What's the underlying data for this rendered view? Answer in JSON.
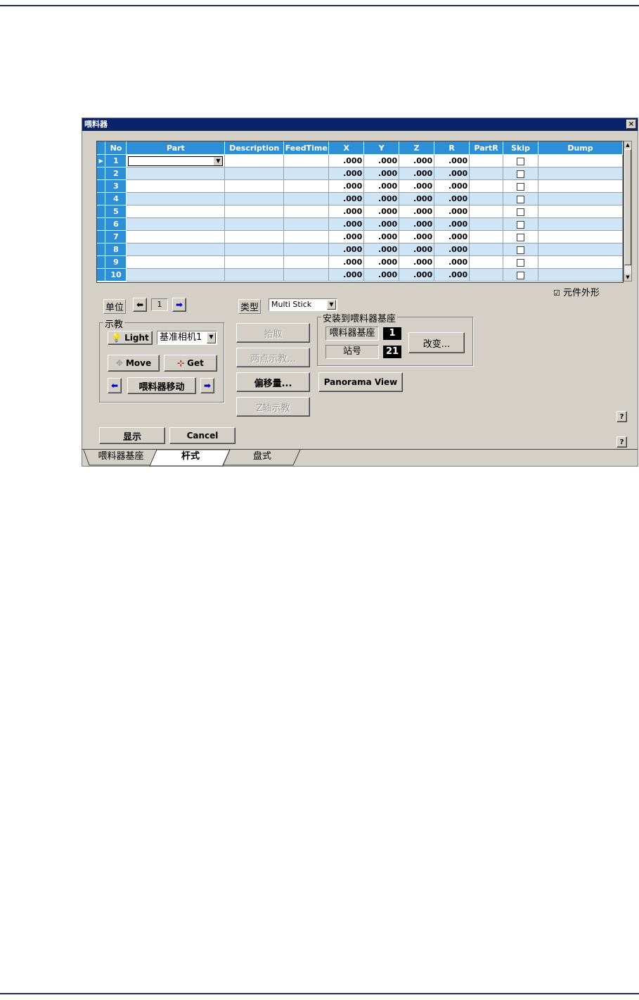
{
  "window": {
    "title": "喂料器",
    "close_label": "×"
  },
  "grid": {
    "columns": [
      "No",
      "Part",
      "Description",
      "FeedTime",
      "X",
      "Y",
      "Z",
      "R",
      "PartR",
      "Skip",
      "Dump"
    ],
    "rows": [
      {
        "no": "1",
        "x": ".000",
        "y": ".000",
        "z": ".000",
        "r": ".000"
      },
      {
        "no": "2",
        "x": ".000",
        "y": ".000",
        "z": ".000",
        "r": ".000"
      },
      {
        "no": "3",
        "x": ".000",
        "y": ".000",
        "z": ".000",
        "r": ".000"
      },
      {
        "no": "4",
        "x": ".000",
        "y": ".000",
        "z": ".000",
        "r": ".000"
      },
      {
        "no": "5",
        "x": ".000",
        "y": ".000",
        "z": ".000",
        "r": ".000"
      },
      {
        "no": "6",
        "x": ".000",
        "y": ".000",
        "z": ".000",
        "r": ".000"
      },
      {
        "no": "7",
        "x": ".000",
        "y": ".000",
        "z": ".000",
        "r": ".000"
      },
      {
        "no": "8",
        "x": ".000",
        "y": ".000",
        "z": ".000",
        "r": ".000"
      },
      {
        "no": "9",
        "x": ".000",
        "y": ".000",
        "z": ".000",
        "r": ".000"
      },
      {
        "no": "10",
        "x": ".000",
        "y": ".000",
        "z": ".000",
        "r": ".000"
      }
    ]
  },
  "outline_checkbox": {
    "label": "元件外形",
    "checked": true,
    "mark": "☑"
  },
  "unit": {
    "label": "单位",
    "value": "1"
  },
  "teach": {
    "group_label": "示教",
    "light_label": "Light",
    "camera_value": "基准相机1",
    "move_label": "Move",
    "get_label": "Get",
    "feeder_move_label": "喂料器移动"
  },
  "type": {
    "label": "类型",
    "value": "Multi Stick"
  },
  "actions": {
    "pick": "拾取",
    "two_point": "两点示教...",
    "offset": "偏移量...",
    "z_teach": "Z轴示教",
    "panorama": "Panorama View"
  },
  "mount": {
    "group_label": "安装到喂料器基座",
    "base_label": "喂料器基座",
    "base_value": "1",
    "station_label": "站号",
    "station_value": "21",
    "change_label": "改变..."
  },
  "footer": {
    "show_label": "显示",
    "cancel_label": "Cancel",
    "help_label": "?"
  },
  "tabs": [
    "喂料器基座",
    "杆式",
    "盘式"
  ]
}
